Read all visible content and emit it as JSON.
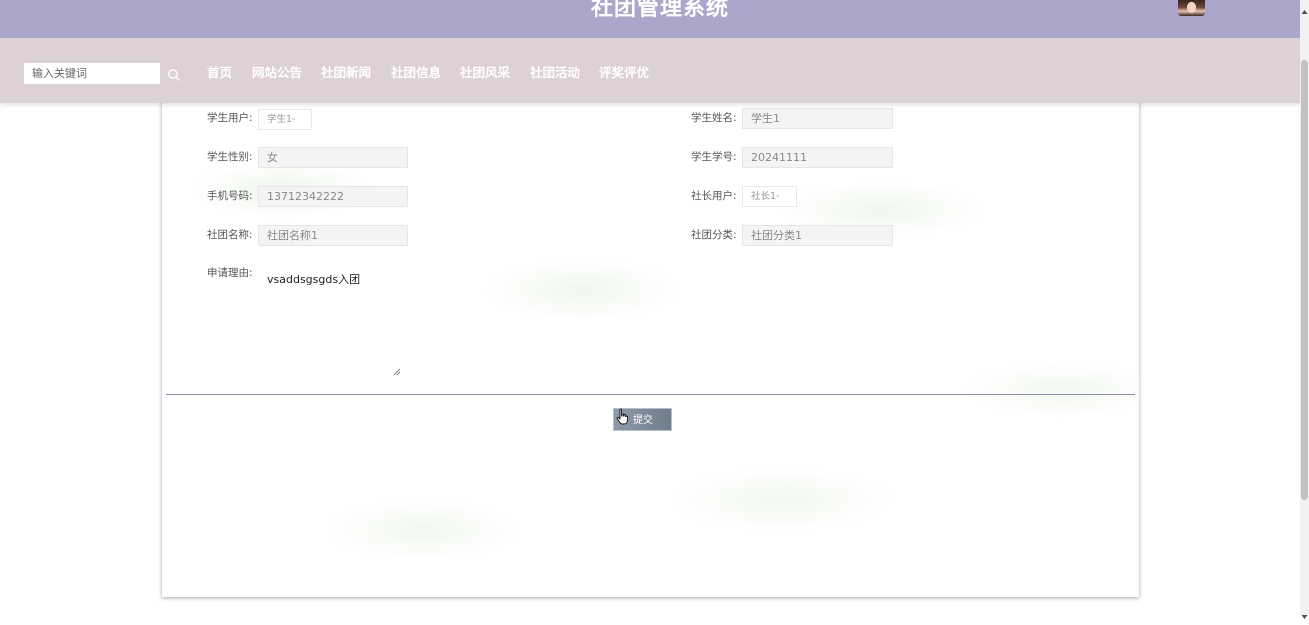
{
  "header": {
    "title": "社团管理系统"
  },
  "nav": {
    "search_placeholder": "输入关键词",
    "items": [
      "首页",
      "网站公告",
      "社团新闻",
      "社团信息",
      "社团风采",
      "社团活动",
      "评奖评优"
    ]
  },
  "form": {
    "student_user": {
      "label": "学生用户:",
      "value": "学生1-"
    },
    "student_name": {
      "label": "学生姓名:",
      "value": "学生1"
    },
    "student_gender": {
      "label": "学生性别:",
      "value": "女"
    },
    "student_no": {
      "label": "学生学号:",
      "value": "20241111"
    },
    "phone": {
      "label": "手机号码:",
      "value": "13712342222"
    },
    "leader_user": {
      "label": "社长用户:",
      "value": "社长1-"
    },
    "club_name": {
      "label": "社团名称:",
      "value": "社团名称1"
    },
    "club_category": {
      "label": "社团分类:",
      "value": "社团分类1"
    },
    "reason": {
      "label": "申请理由:",
      "value": "vsaddsgsgds入团"
    },
    "submit_label": "提交"
  },
  "colors": {
    "header_bg": "#aba7cc",
    "nav_bg": "#ddd1d6",
    "button_bg": "#7f8b99"
  }
}
